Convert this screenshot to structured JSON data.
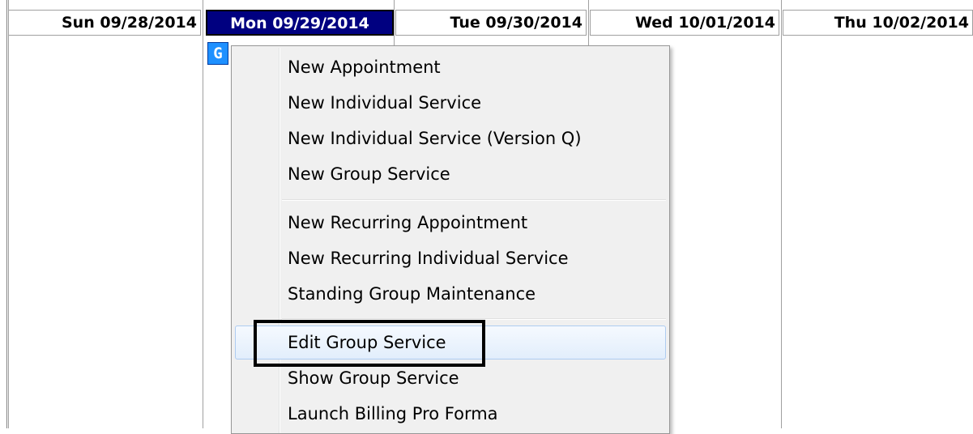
{
  "calendar": {
    "days": [
      {
        "label": "Sun 09/28/2014",
        "selected": false
      },
      {
        "label": "Mon 09/29/2014",
        "selected": true
      },
      {
        "label": "Tue 09/30/2014",
        "selected": false
      },
      {
        "label": "Wed 10/01/2014",
        "selected": false
      },
      {
        "label": "Thu 10/02/2014",
        "selected": false
      }
    ],
    "group_badge": "G",
    "colors": {
      "selected_header": "#000080",
      "badge": "#1e90ff"
    }
  },
  "context_menu": {
    "items": [
      {
        "label": "New Appointment"
      },
      {
        "label": "New Individual Service"
      },
      {
        "label": "New Individual Service (Version Q)"
      },
      {
        "label": "New Group Service"
      },
      {
        "label": "New Recurring Appointment"
      },
      {
        "label": "New Recurring Individual Service"
      },
      {
        "label": "Standing Group Maintenance"
      },
      {
        "label": "Edit Group Service",
        "hovered": true,
        "annotated": true
      },
      {
        "label": "Show Group Service"
      },
      {
        "label": "Launch Billing Pro Forma"
      }
    ]
  }
}
